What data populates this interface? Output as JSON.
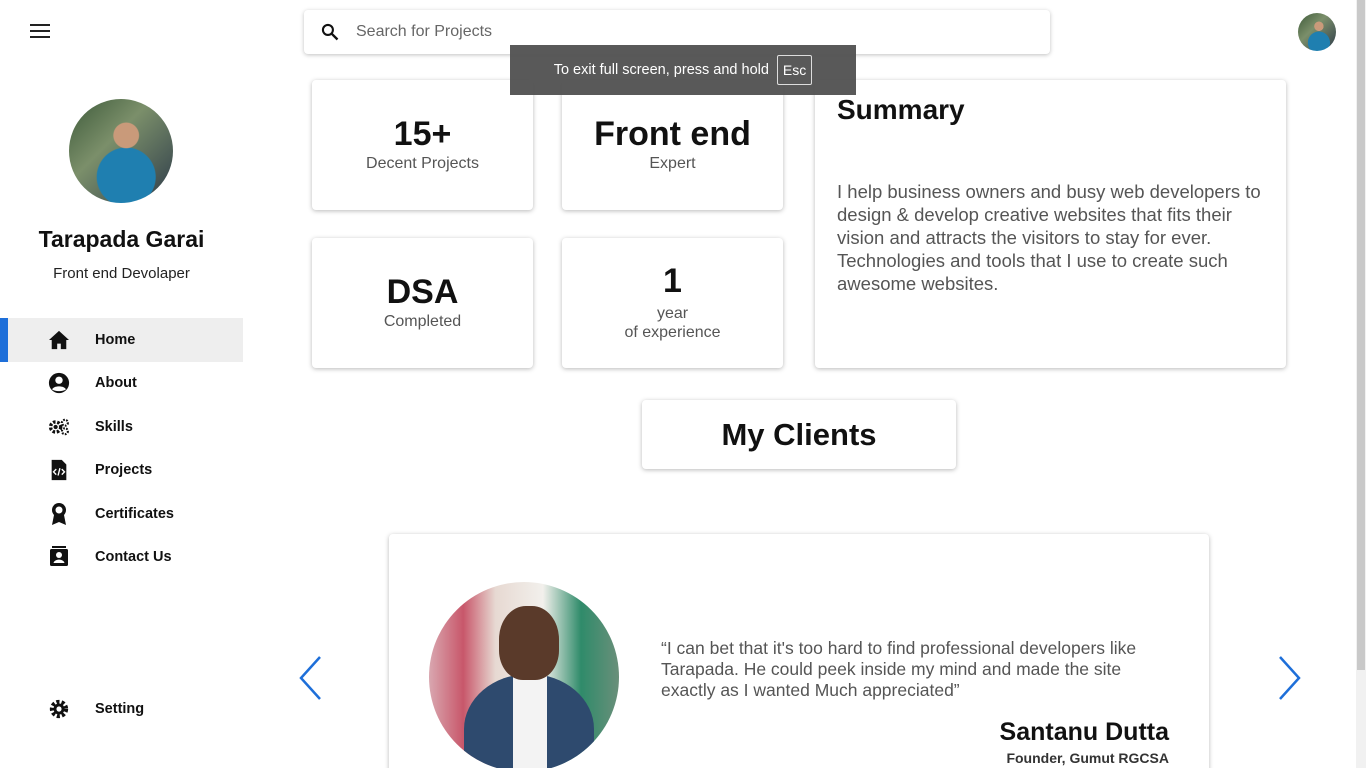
{
  "header": {
    "search_placeholder": "Search for Projects",
    "toast_text": "To exit full screen, press and hold",
    "toast_key": "Esc"
  },
  "profile": {
    "name": "Tarapada Garai",
    "role": "Front end Devolaper"
  },
  "sidebar": {
    "items": [
      {
        "label": "Home",
        "icon": "home-icon",
        "active": true
      },
      {
        "label": "About",
        "icon": "account-circle-icon",
        "active": false
      },
      {
        "label": "Skills",
        "icon": "gears-icon",
        "active": false
      },
      {
        "label": "Projects",
        "icon": "code-file-icon",
        "active": false
      },
      {
        "label": "Certificates",
        "icon": "award-icon",
        "active": false
      },
      {
        "label": "Contact Us",
        "icon": "contact-card-icon",
        "active": false
      }
    ],
    "setting_label": "Setting"
  },
  "stats": [
    {
      "value": "15+",
      "label": "Decent Projects"
    },
    {
      "value": "Front end",
      "label": "Expert"
    },
    {
      "value": "DSA",
      "label": "Completed"
    },
    {
      "value": "1",
      "label": "year",
      "label2": "of experience"
    }
  ],
  "summary": {
    "title": "Summary",
    "text": "I help business owners and busy web developers to design & develop creative websites that fits their vision and attracts the visitors to stay for ever. Technologies and tools that I use to create such awesome websites."
  },
  "clients": {
    "title": "My Clients",
    "quote": "“I can bet that it's too hard to find professional developers like Tarapada. He could peek inside my mind and made the site exactly as I wanted Much appreciated”",
    "name": "Santanu Dutta",
    "role": "Founder, Gumut RGCSA"
  },
  "colors": {
    "accent": "#1e6fd9",
    "active_bg": "#eeeeee"
  }
}
